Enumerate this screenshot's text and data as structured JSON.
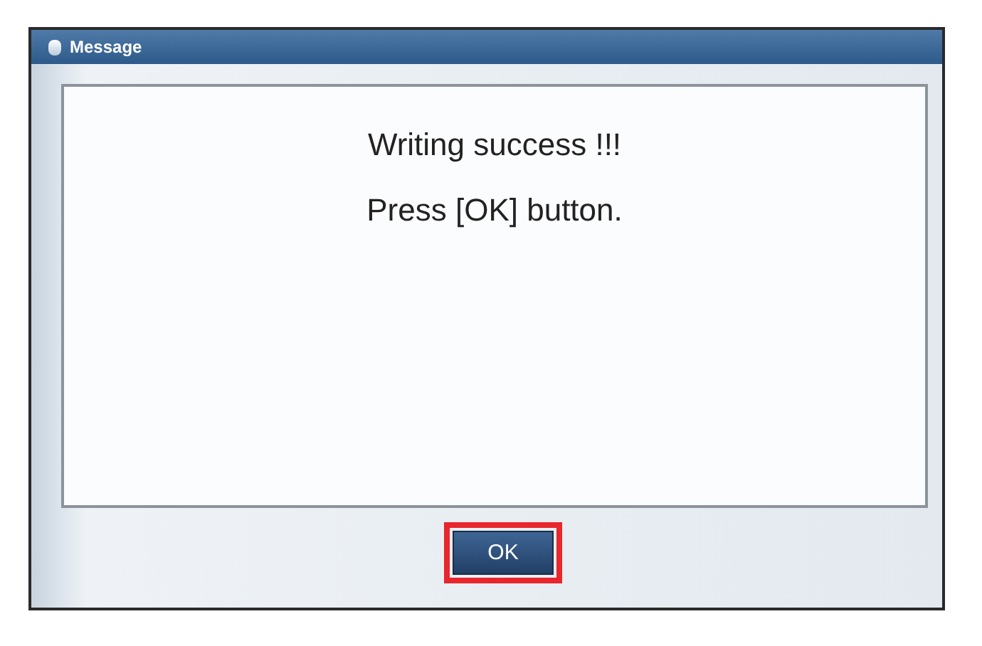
{
  "window": {
    "title": "Message"
  },
  "message": {
    "lines": [
      "Writing success !!!",
      "Press [OK] button."
    ]
  },
  "buttons": [
    {
      "label": "OK",
      "highlighted": true
    }
  ]
}
